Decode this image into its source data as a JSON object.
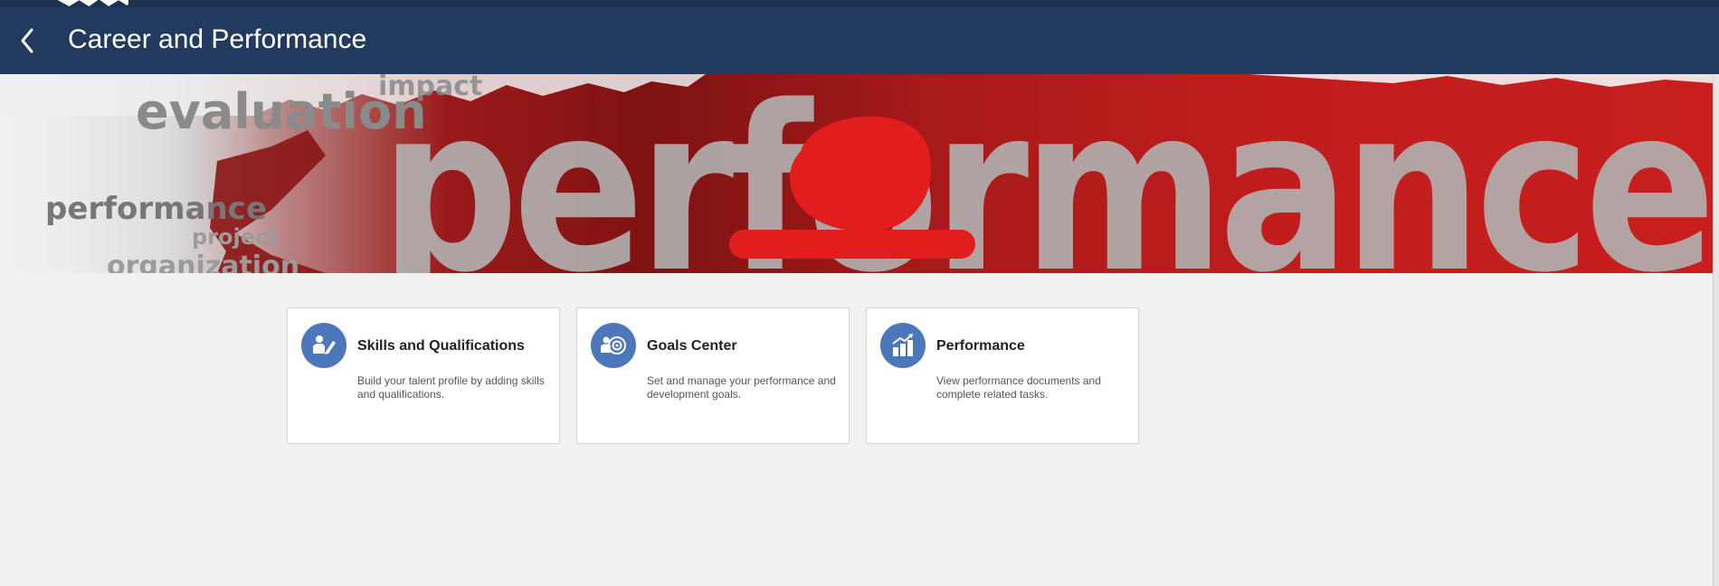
{
  "header": {
    "title": "Career and Performance",
    "back_icon": "chevron-left-icon"
  },
  "banner": {
    "big_word": "performance",
    "words": [
      "impact",
      "evaluation",
      "performance",
      "project",
      "organization"
    ]
  },
  "cards": [
    {
      "title": "Skills and Qualifications",
      "description": "Build your talent profile by adding skills and qualifications.",
      "icon": "person-edit-icon"
    },
    {
      "title": "Goals Center",
      "description": "Set and manage your performance and development goals.",
      "icon": "target-person-icon"
    },
    {
      "title": "Performance",
      "description": "View performance documents and complete related tasks.",
      "icon": "bar-chart-trend-icon"
    }
  ],
  "colors": {
    "header_bg": "#213a5e",
    "top_strip": "#1b3251",
    "icon_bg": "#4d77bb",
    "page_bg": "#f1f1f1",
    "banner_red": "#c21d1d"
  }
}
